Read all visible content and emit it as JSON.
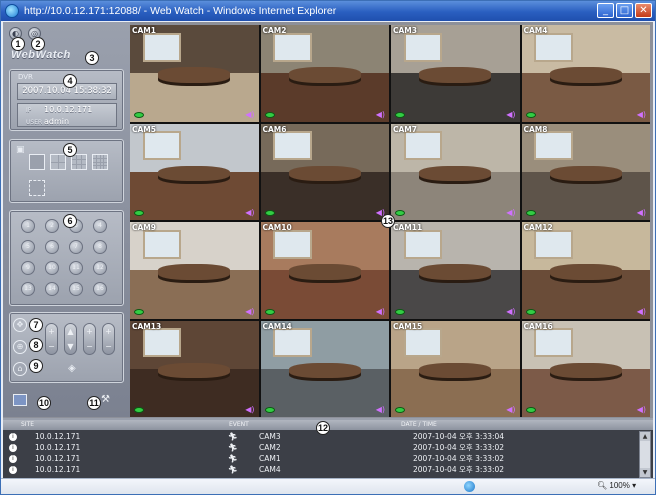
{
  "window": {
    "title": "http://10.0.12.171:12088/ - Web Watch - Windows Internet Explorer",
    "min": "_",
    "max": "□",
    "close": "✕"
  },
  "sidebar": {
    "logo": "WebWatch",
    "dvr": {
      "label": "DVR",
      "datetime": "2007.10.04 15:38:32",
      "ip_label": "IP",
      "ip": "10.0.12.171",
      "user_label": "USER",
      "user": "admin"
    },
    "layout_icon": "layout-icon",
    "camera_buttons": [
      "1",
      "2",
      "3",
      "4",
      "5",
      "6",
      "7",
      "8",
      "9",
      "10",
      "11",
      "12",
      "13",
      "14",
      "15",
      "16"
    ]
  },
  "cameras": [
    {
      "label": "CAM1",
      "wall": "#5a4a3c",
      "floor": "#b9a88e"
    },
    {
      "label": "CAM2",
      "wall": "#8c8474",
      "floor": "#5b3b2a"
    },
    {
      "label": "CAM3",
      "wall": "#a7a095",
      "floor": "#3d3a37"
    },
    {
      "label": "CAM4",
      "wall": "#c9bba3",
      "floor": "#7a5a44"
    },
    {
      "label": "CAM5",
      "wall": "#c2c7cc",
      "floor": "#6e4a34"
    },
    {
      "label": "CAM6",
      "wall": "#776a5a",
      "floor": "#3a2f28"
    },
    {
      "label": "CAM7",
      "wall": "#bdb6a8",
      "floor": "#8d857a"
    },
    {
      "label": "CAM8",
      "wall": "#9a8e7c",
      "floor": "#5e544a"
    },
    {
      "label": "CAM9",
      "wall": "#d7d2ca",
      "floor": "#8a6e55"
    },
    {
      "label": "CAM10",
      "wall": "#a87b5e",
      "floor": "#7a4b36"
    },
    {
      "label": "CAM11",
      "wall": "#b8b4ad",
      "floor": "#4a4848"
    },
    {
      "label": "CAM12",
      "wall": "#c7b89c",
      "floor": "#6a4c38"
    },
    {
      "label": "CAM13",
      "wall": "#5e4636",
      "floor": "#3e2c22"
    },
    {
      "label": "CAM14",
      "wall": "#8f9da3",
      "floor": "#5a6064"
    },
    {
      "label": "CAM15",
      "wall": "#b9a488",
      "floor": "#8b6e52"
    },
    {
      "label": "CAM16",
      "wall": "#c8c1b4",
      "floor": "#7c5a48"
    }
  ],
  "events": {
    "headers": {
      "site": "SITE",
      "event": "EVENT",
      "datetime": "DATE / TIME"
    },
    "rows": [
      {
        "site": "10.0.12.171",
        "event": "CAM3",
        "datetime": "2007-10-04 오후 3:33:04"
      },
      {
        "site": "10.0.12.171",
        "event": "CAM2",
        "datetime": "2007-10-04 오후 3:33:02"
      },
      {
        "site": "10.0.12.171",
        "event": "CAM1",
        "datetime": "2007-10-04 오후 3:33:02"
      },
      {
        "site": "10.0.12.171",
        "event": "CAM4",
        "datetime": "2007-10-04 오후 3:33:02"
      }
    ]
  },
  "statusbar": {
    "zoom": "100%"
  },
  "callouts": [
    "1",
    "2",
    "3",
    "4",
    "5",
    "6",
    "7",
    "8",
    "9",
    "10",
    "11",
    "12",
    "13"
  ]
}
